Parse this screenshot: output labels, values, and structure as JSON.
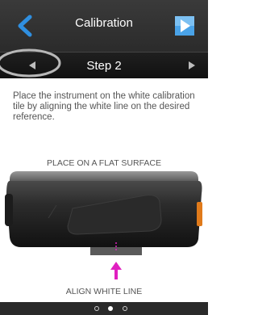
{
  "header": {
    "title": "Calibration",
    "back_icon": "chevron-left-icon",
    "next_icon": "play-forward-icon",
    "accent_color": "#2f8fe0"
  },
  "stepbar": {
    "title": "Step 2",
    "prev_icon": "triangle-left-icon",
    "next_icon": "triangle-right-icon"
  },
  "content": {
    "instructions": "Place the instrument on the white calibration tile by aligning the white line on the desired reference.",
    "place_label": "PLACE ON A FLAT SURFACE",
    "align_label": "ALIGN WHITE LINE",
    "indicator_color": "#e020c0"
  },
  "pager": {
    "pages": 3,
    "active_index": 1
  }
}
